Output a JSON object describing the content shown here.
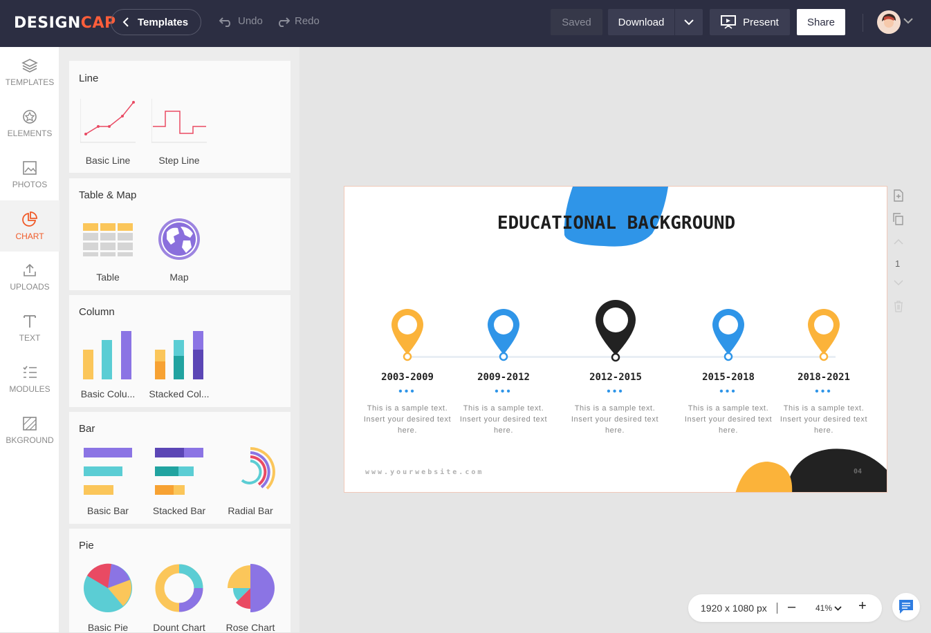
{
  "topbar": {
    "logo_a": "DESIGN",
    "logo_b": "CAP",
    "templates_label": "Templates",
    "undo_label": "Undo",
    "redo_label": "Redo",
    "saved_label": "Saved",
    "download_label": "Download",
    "present_label": "Present",
    "share_label": "Share"
  },
  "rail": {
    "items": [
      {
        "label": "TEMPLATES",
        "icon": "layers-icon"
      },
      {
        "label": "ELEMENTS",
        "icon": "elements-icon"
      },
      {
        "label": "PHOTOS",
        "icon": "image-icon"
      },
      {
        "label": "CHART",
        "icon": "pie-chart-icon",
        "active": true
      },
      {
        "label": "UPLOADS",
        "icon": "upload-icon"
      },
      {
        "label": "TEXT",
        "icon": "text-icon"
      },
      {
        "label": "MODULES",
        "icon": "list-icon"
      },
      {
        "label": "BKGROUND",
        "icon": "background-icon"
      }
    ]
  },
  "panel": {
    "line": {
      "title": "Line",
      "items": [
        "Basic Line",
        "Step Line"
      ]
    },
    "table_map": {
      "title": "Table & Map",
      "items": [
        "Table",
        "Map"
      ]
    },
    "column": {
      "title": "Column",
      "items": [
        "Basic Colu...",
        "Stacked Col..."
      ]
    },
    "bar": {
      "title": "Bar",
      "items": [
        "Basic Bar",
        "Stacked Bar",
        "Radial Bar"
      ]
    },
    "pie": {
      "title": "Pie",
      "items": [
        "Basic Pie",
        "Dount Chart",
        "Rose Chart"
      ]
    }
  },
  "canvas": {
    "title": "EDUCATIONAL BACKGROUND",
    "milestones": [
      {
        "years": "2003-2009",
        "desc": "This is a sample text. Insert your desired text here.",
        "color": "#fbb33a"
      },
      {
        "years": "2009-2012",
        "desc": "This is a sample text. Insert your desired text here.",
        "color": "#2f95e8"
      },
      {
        "years": "2012-2015",
        "desc": "This is a sample text. Insert your desired text here.",
        "color": "#222222"
      },
      {
        "years": "2015-2018",
        "desc": "This is a sample text. Insert your desired text here.",
        "color": "#2f95e8"
      },
      {
        "years": "2018-2021",
        "desc": "This is a sample text. Insert your desired text here.",
        "color": "#fbb33a"
      }
    ],
    "dots": "•••",
    "website": "www.yourwebsite.com",
    "page_number": "04"
  },
  "side_tools": {
    "page_indicator": "1"
  },
  "zoom": {
    "size": "1920 x 1080 px",
    "value": "41%",
    "minus": "–",
    "plus": "+"
  },
  "colors": {
    "accent": "#f05a28",
    "topbar": "#2c2e42",
    "blue": "#2f95e8",
    "yellow": "#fbb33a",
    "dark": "#222222"
  }
}
